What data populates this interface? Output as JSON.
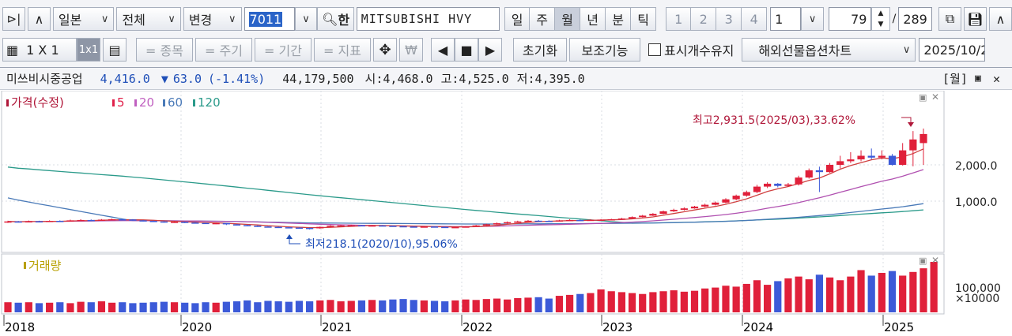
{
  "toolbar": {
    "market": "일본",
    "scope": "전체",
    "change": "변경",
    "code": "7011",
    "han": "한",
    "name": "MITSUBISHI HVY",
    "periods": [
      "일",
      "주",
      "월",
      "년",
      "분",
      "틱"
    ],
    "active_period": "월",
    "numbers": [
      "1",
      "2",
      "3",
      "4"
    ],
    "n_value": "1",
    "count": "79",
    "total": "289"
  },
  "toolbar2": {
    "layout_label": "1 X 1",
    "grid_label": "1x1",
    "jongmok": "= 종목",
    "jugi": "= 주기",
    "gigan": "= 기간",
    "jipyo": "= 지표",
    "won": "₩",
    "reset": "초기화",
    "aux": "보조기능",
    "keep_count": "표시개수유지",
    "overseas": "해외선물옵션차트",
    "date": "2025/10/2"
  },
  "info": {
    "name": "미쓰비시중공업",
    "price": "4,416.0",
    "change": "63.0",
    "pct": "(-1.41%)",
    "volume": "44,179,500",
    "open": "시:4,468.0",
    "high": "고:4,525.0",
    "low": "저:4,395.0",
    "period_tag": "[월]"
  },
  "legend": {
    "price": "가격(수정)",
    "ma": [
      {
        "label": "5",
        "color": "#e0204a"
      },
      {
        "label": "20",
        "color": "#c060c0"
      },
      {
        "label": "60",
        "color": "#4a7ab8"
      },
      {
        "label": "120",
        "color": "#2a9a8a"
      }
    ],
    "volume": "거래량"
  },
  "colors": {
    "up": "#e0203a",
    "down": "#3c5ad8",
    "ma5": "#d04040",
    "ma20": "#b050b0",
    "ma60": "#4a7ab8",
    "ma120": "#2a9a8a"
  },
  "annotations": {
    "high": "최고2,931.5(2025/03),33.62%",
    "low": "최저218.1(2020/10),95.06%"
  },
  "axis": {
    "price_ticks": [
      "2,000.0",
      "1,000.0"
    ],
    "volume_ticks": [
      "100,000",
      "×10000"
    ],
    "years": [
      "2018",
      "2020",
      "2021",
      "2022",
      "2023",
      "2024",
      "2025"
    ]
  },
  "chart_data": {
    "type": "candlestick",
    "period": "monthly",
    "ylim": [
      0,
      3500
    ],
    "candles": [
      {
        "o": 420,
        "c": 440,
        "h": 460,
        "l": 400
      },
      {
        "o": 440,
        "c": 425,
        "h": 455,
        "l": 410
      },
      {
        "o": 425,
        "c": 445,
        "h": 465,
        "l": 415
      },
      {
        "o": 445,
        "c": 440,
        "h": 460,
        "l": 425
      },
      {
        "o": 440,
        "c": 455,
        "h": 470,
        "l": 430
      },
      {
        "o": 455,
        "c": 450,
        "h": 470,
        "l": 440
      },
      {
        "o": 450,
        "c": 470,
        "h": 490,
        "l": 440
      },
      {
        "o": 470,
        "c": 480,
        "h": 500,
        "l": 455
      },
      {
        "o": 480,
        "c": 470,
        "h": 495,
        "l": 460
      },
      {
        "o": 470,
        "c": 490,
        "h": 505,
        "l": 460
      },
      {
        "o": 490,
        "c": 500,
        "h": 520,
        "l": 475
      },
      {
        "o": 500,
        "c": 495,
        "h": 515,
        "l": 480
      },
      {
        "o": 495,
        "c": 470,
        "h": 505,
        "l": 460
      },
      {
        "o": 470,
        "c": 455,
        "h": 480,
        "l": 440
      },
      {
        "o": 455,
        "c": 440,
        "h": 465,
        "l": 425
      },
      {
        "o": 440,
        "c": 420,
        "h": 450,
        "l": 405
      },
      {
        "o": 420,
        "c": 430,
        "h": 445,
        "l": 405
      },
      {
        "o": 430,
        "c": 410,
        "h": 440,
        "l": 395
      },
      {
        "o": 410,
        "c": 400,
        "h": 425,
        "l": 385
      },
      {
        "o": 400,
        "c": 380,
        "h": 410,
        "l": 370
      },
      {
        "o": 380,
        "c": 395,
        "h": 405,
        "l": 365
      },
      {
        "o": 395,
        "c": 360,
        "h": 400,
        "l": 340
      },
      {
        "o": 360,
        "c": 340,
        "h": 370,
        "l": 330
      },
      {
        "o": 340,
        "c": 320,
        "h": 350,
        "l": 310
      },
      {
        "o": 320,
        "c": 300,
        "h": 335,
        "l": 290
      },
      {
        "o": 300,
        "c": 290,
        "h": 310,
        "l": 280
      },
      {
        "o": 290,
        "c": 280,
        "h": 300,
        "l": 260
      },
      {
        "o": 280,
        "c": 270,
        "h": 290,
        "l": 250
      },
      {
        "o": 270,
        "c": 262,
        "h": 280,
        "l": 240
      },
      {
        "o": 262,
        "c": 250,
        "h": 270,
        "l": 218
      },
      {
        "o": 250,
        "c": 290,
        "h": 300,
        "l": 240
      },
      {
        "o": 290,
        "c": 320,
        "h": 335,
        "l": 280
      },
      {
        "o": 320,
        "c": 330,
        "h": 345,
        "l": 310
      },
      {
        "o": 330,
        "c": 335,
        "h": 350,
        "l": 320
      },
      {
        "o": 335,
        "c": 325,
        "h": 345,
        "l": 310
      },
      {
        "o": 325,
        "c": 330,
        "h": 340,
        "l": 315
      },
      {
        "o": 330,
        "c": 320,
        "h": 340,
        "l": 305
      },
      {
        "o": 320,
        "c": 310,
        "h": 330,
        "l": 300
      },
      {
        "o": 310,
        "c": 300,
        "h": 320,
        "l": 290
      },
      {
        "o": 300,
        "c": 290,
        "h": 310,
        "l": 280
      },
      {
        "o": 290,
        "c": 300,
        "h": 310,
        "l": 280
      },
      {
        "o": 300,
        "c": 290,
        "h": 310,
        "l": 275
      },
      {
        "o": 290,
        "c": 280,
        "h": 300,
        "l": 270
      },
      {
        "o": 280,
        "c": 285,
        "h": 295,
        "l": 270
      },
      {
        "o": 285,
        "c": 300,
        "h": 310,
        "l": 275
      },
      {
        "o": 300,
        "c": 330,
        "h": 345,
        "l": 295
      },
      {
        "o": 330,
        "c": 360,
        "h": 375,
        "l": 320
      },
      {
        "o": 360,
        "c": 390,
        "h": 410,
        "l": 350
      },
      {
        "o": 390,
        "c": 420,
        "h": 440,
        "l": 380
      },
      {
        "o": 420,
        "c": 440,
        "h": 460,
        "l": 410
      },
      {
        "o": 440,
        "c": 460,
        "h": 480,
        "l": 430
      },
      {
        "o": 460,
        "c": 455,
        "h": 480,
        "l": 440
      },
      {
        "o": 455,
        "c": 450,
        "h": 470,
        "l": 440
      },
      {
        "o": 450,
        "c": 470,
        "h": 485,
        "l": 440
      },
      {
        "o": 470,
        "c": 480,
        "h": 500,
        "l": 460
      },
      {
        "o": 480,
        "c": 470,
        "h": 495,
        "l": 455
      },
      {
        "o": 470,
        "c": 485,
        "h": 500,
        "l": 460
      },
      {
        "o": 485,
        "c": 490,
        "h": 505,
        "l": 470
      },
      {
        "o": 490,
        "c": 500,
        "h": 515,
        "l": 480
      },
      {
        "o": 500,
        "c": 520,
        "h": 540,
        "l": 490
      },
      {
        "o": 520,
        "c": 560,
        "h": 580,
        "l": 510
      },
      {
        "o": 560,
        "c": 600,
        "h": 620,
        "l": 550
      },
      {
        "o": 600,
        "c": 650,
        "h": 670,
        "l": 590
      },
      {
        "o": 650,
        "c": 720,
        "h": 740,
        "l": 640
      },
      {
        "o": 720,
        "c": 760,
        "h": 790,
        "l": 700
      },
      {
        "o": 760,
        "c": 800,
        "h": 830,
        "l": 740
      },
      {
        "o": 800,
        "c": 850,
        "h": 870,
        "l": 790
      },
      {
        "o": 850,
        "c": 900,
        "h": 930,
        "l": 830
      },
      {
        "o": 900,
        "c": 960,
        "h": 990,
        "l": 880
      },
      {
        "o": 960,
        "c": 1050,
        "h": 1080,
        "l": 940
      },
      {
        "o": 1050,
        "c": 1150,
        "h": 1180,
        "l": 1020
      },
      {
        "o": 1150,
        "c": 1250,
        "h": 1290,
        "l": 1120
      },
      {
        "o": 1250,
        "c": 1400,
        "h": 1450,
        "l": 1220
      },
      {
        "o": 1400,
        "c": 1480,
        "h": 1520,
        "l": 1360
      },
      {
        "o": 1480,
        "c": 1420,
        "h": 1500,
        "l": 1380
      },
      {
        "o": 1420,
        "c": 1460,
        "h": 1500,
        "l": 1390
      },
      {
        "o": 1460,
        "c": 1650,
        "h": 1700,
        "l": 1430
      },
      {
        "o": 1650,
        "c": 1850,
        "h": 1900,
        "l": 1620
      },
      {
        "o": 1850,
        "c": 1800,
        "h": 1950,
        "l": 1250
      },
      {
        "o": 1800,
        "c": 2000,
        "h": 2050,
        "l": 1780
      },
      {
        "o": 2000,
        "c": 2100,
        "h": 2250,
        "l": 1900
      },
      {
        "o": 2100,
        "c": 2150,
        "h": 2350,
        "l": 2050
      },
      {
        "o": 2150,
        "c": 2250,
        "h": 2400,
        "l": 2100
      },
      {
        "o": 2250,
        "c": 2200,
        "h": 2450,
        "l": 2150
      },
      {
        "o": 2200,
        "c": 2250,
        "h": 2400,
        "l": 2150
      },
      {
        "o": 2250,
        "c": 2000,
        "h": 2300,
        "l": 1980
      },
      {
        "o": 2000,
        "c": 2400,
        "h": 2600,
        "l": 1980
      },
      {
        "o": 2400,
        "c": 2700,
        "h": 2931.5,
        "l": 1960
      },
      {
        "o": 2600,
        "c": 2850,
        "h": 3000,
        "l": 2000
      }
    ],
    "volumes": [
      22,
      21,
      22,
      20,
      21,
      22,
      20,
      23,
      22,
      24,
      21,
      22,
      20,
      21,
      22,
      23,
      22,
      21,
      20,
      22,
      21,
      23,
      24,
      26,
      22,
      25,
      24,
      23,
      25,
      24,
      26,
      27,
      24,
      25,
      26,
      27,
      26,
      28,
      29,
      27,
      26,
      25,
      24,
      26,
      28,
      27,
      29,
      30,
      28,
      31,
      32,
      33,
      30,
      36,
      38,
      40,
      42,
      50,
      46,
      44,
      42,
      40,
      44,
      46,
      48,
      45,
      47,
      52,
      54,
      58,
      56,
      62,
      70,
      60,
      68,
      74,
      78,
      72,
      82,
      76,
      70,
      78,
      92,
      80,
      86,
      90,
      80,
      88,
      96,
      110
    ],
    "volume_colors": "up/down matching candles"
  }
}
